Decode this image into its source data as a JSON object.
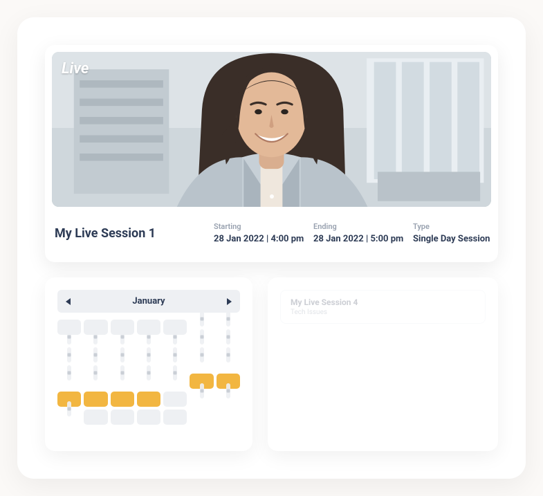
{
  "session": {
    "badge": "Live",
    "title": "My Live Session 1",
    "starting_label": "Starting",
    "starting_value": "28 Jan 2022 | 4:00 pm",
    "ending_label": "Ending",
    "ending_value": "28 Jan 2022 | 5:00 pm",
    "type_label": "Type",
    "type_value": "Single Day Session"
  },
  "calendar": {
    "month": "January",
    "rows": [
      [
        "blank",
        "blank",
        "blank",
        "blank",
        "blank",
        "dot",
        "dot"
      ],
      [
        "dot",
        "dot",
        "dot",
        "dot",
        "dot",
        "dot",
        "dot"
      ],
      [
        "dot",
        "dot",
        "dot",
        "dot",
        "dot",
        "dot",
        "dot"
      ],
      [
        "dot",
        "dot",
        "dot",
        "dot",
        "dot",
        "hl",
        "hl"
      ],
      [
        "hl",
        "hl",
        "hl",
        "hl",
        "blank",
        "dot",
        "dot"
      ],
      [
        "dot",
        "blank",
        "blank",
        "blank",
        "blank",
        "empty",
        "empty"
      ]
    ]
  },
  "events": [
    {
      "title": "My Live Session 4",
      "sub": "Tech Issues"
    }
  ]
}
